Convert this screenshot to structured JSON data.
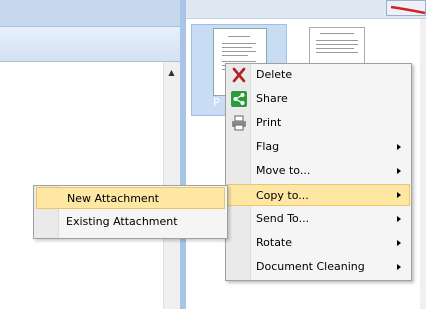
{
  "thumbnails": {
    "selected_label": "P"
  },
  "scrollbar": {
    "up_arrow": "▲"
  },
  "context_menu": {
    "items": [
      {
        "label": "Delete",
        "icon": "delete-x-icon",
        "has_submenu": false
      },
      {
        "label": "Share",
        "icon": "share-icon",
        "has_submenu": false
      },
      {
        "label": "Print",
        "icon": "printer-icon",
        "has_submenu": false
      },
      {
        "label": "Flag",
        "icon": "",
        "has_submenu": true
      },
      {
        "label": "Move to...",
        "icon": "",
        "has_submenu": true
      },
      {
        "label": "Copy to...",
        "icon": "",
        "has_submenu": true,
        "highlighted": true
      },
      {
        "label": "Send To...",
        "icon": "",
        "has_submenu": true
      },
      {
        "label": "Rotate",
        "icon": "",
        "has_submenu": true
      },
      {
        "label": "Document Cleaning",
        "icon": "",
        "has_submenu": true
      }
    ]
  },
  "submenu": {
    "items": [
      {
        "label": "New Attachment",
        "highlighted": true
      },
      {
        "label": "Existing Attachment"
      }
    ]
  },
  "colors": {
    "highlight": "#fde7a3",
    "highlight_border": "#e7c869",
    "pane_blue": "#a8c4e6",
    "delete_red": "#b22222",
    "share_green": "#2e9a3e"
  }
}
